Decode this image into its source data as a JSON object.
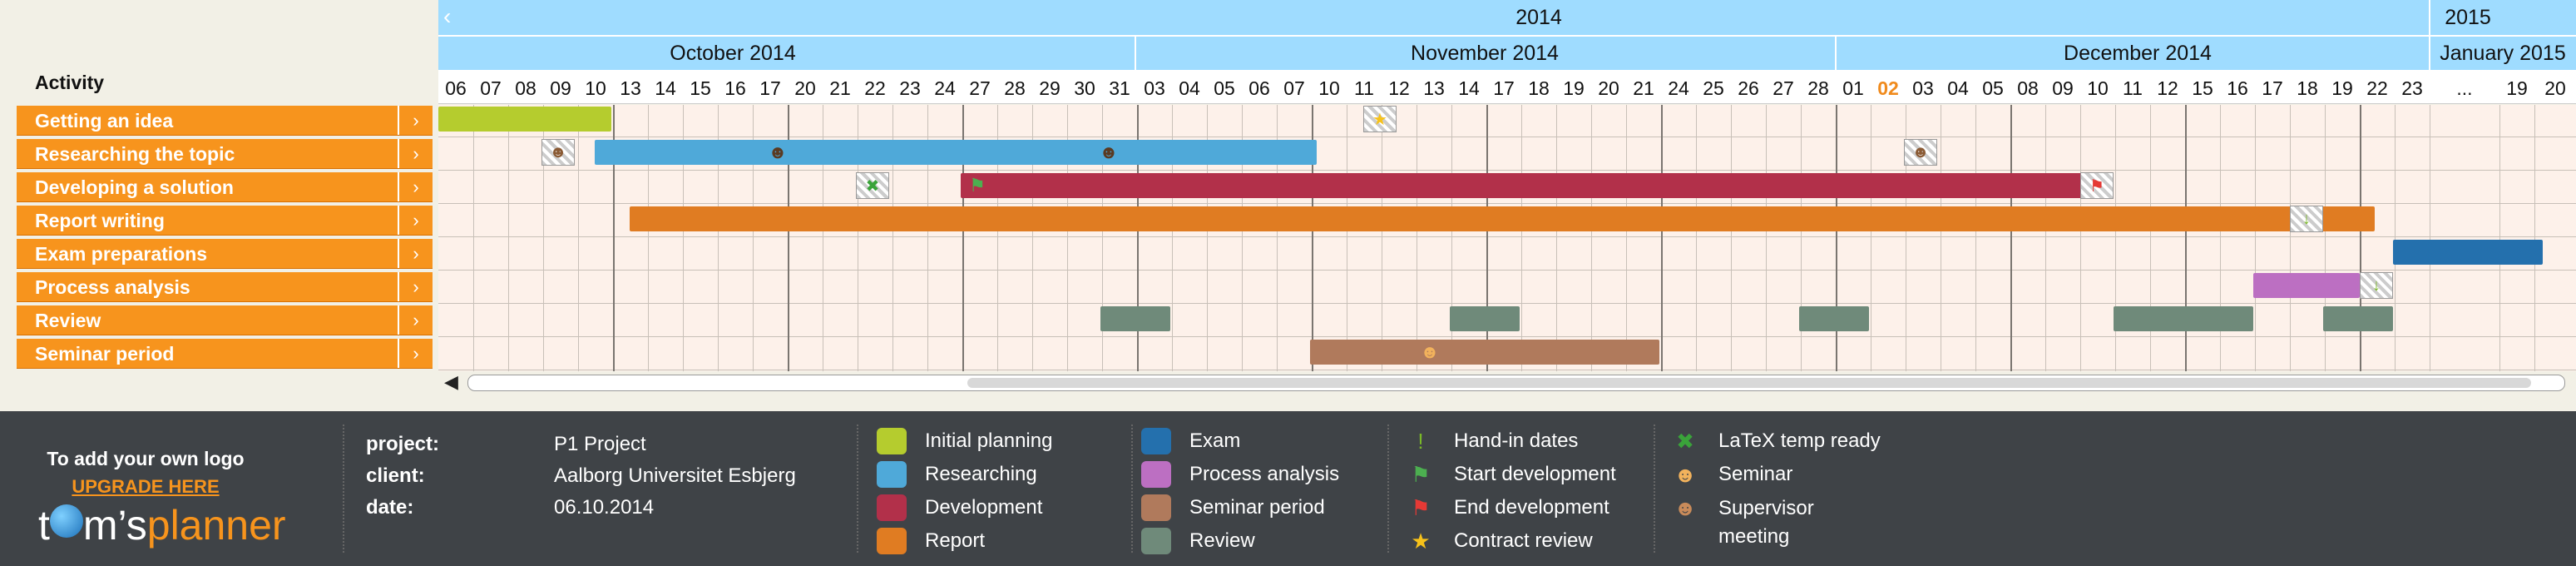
{
  "timeline": {
    "year_row": [
      {
        "name": "year-2014",
        "label": "2014",
        "nav_left": "‹"
      },
      {
        "name": "year-2015",
        "label": "2015"
      }
    ],
    "month_row": [
      {
        "name": "month-oct-2014",
        "label": "October 2014"
      },
      {
        "name": "month-nov-2014",
        "label": "November 2014"
      },
      {
        "name": "month-dec-2014",
        "label": "December 2014"
      },
      {
        "name": "month-jan-2015",
        "label": "January 2015"
      }
    ],
    "days": [
      "06",
      "07",
      "08",
      "09",
      "10",
      "13",
      "14",
      "15",
      "16",
      "17",
      "20",
      "21",
      "22",
      "23",
      "24",
      "27",
      "28",
      "29",
      "30",
      "31",
      "03",
      "04",
      "05",
      "06",
      "07",
      "10",
      "11",
      "12",
      "13",
      "14",
      "17",
      "18",
      "19",
      "20",
      "21",
      "24",
      "25",
      "26",
      "27",
      "28",
      "01",
      "02",
      "03",
      "04",
      "05",
      "08",
      "09",
      "10",
      "11",
      "12",
      "15",
      "16",
      "17",
      "18",
      "19",
      "22",
      "23",
      "...",
      "19",
      "20"
    ],
    "today_label": "02"
  },
  "activity_header": "Activity",
  "activities": [
    {
      "label": "Getting an idea",
      "expand": "›"
    },
    {
      "label": "Researching the topic",
      "expand": "›"
    },
    {
      "label": "Developing a solution",
      "expand": "›"
    },
    {
      "label": "Report writing",
      "expand": "›"
    },
    {
      "label": "Exam preparations",
      "expand": "›"
    },
    {
      "label": "Process analysis",
      "expand": "›"
    },
    {
      "label": "Review",
      "expand": "›"
    },
    {
      "label": "Seminar period",
      "expand": "›"
    }
  ],
  "scrollbar": {
    "left_arrow": "◀",
    "position": 0.24
  },
  "footer": {
    "logo_prompt": "To add your own logo",
    "upgrade_link": "UPGRADE HERE",
    "brand": {
      "t": "t",
      "o": "o",
      "m": "m’s",
      "planner": "planner"
    },
    "project_label": "project:",
    "project_value": "P1 Project",
    "client_label": "client:",
    "client_value": "Aalborg Universitet Esbjerg",
    "date_label": "date:",
    "date_value": "06.10.2014",
    "legend_colors": [
      {
        "label": "Initial planning",
        "color": "#b5cc2e"
      },
      {
        "label": "Researching",
        "color": "#4fa9d9"
      },
      {
        "label": "Development",
        "color": "#b2304a"
      },
      {
        "label": "Report",
        "color": "#e07c22"
      },
      {
        "label": "Exam",
        "color": "#2470ad"
      },
      {
        "label": "Process analysis",
        "color": "#bc6fc2"
      },
      {
        "label": "Seminar period",
        "color": "#b07a5c"
      },
      {
        "label": "Review",
        "color": "#6f8a7a"
      }
    ],
    "legend_markers": [
      {
        "label": "Hand-in dates",
        "icon": "exclamation-icon",
        "glyph": "!",
        "color": "#7ab928"
      },
      {
        "label": "Start development",
        "icon": "flag-green-icon",
        "glyph": "⚑",
        "color": "#4caf50"
      },
      {
        "label": "End development",
        "icon": "flag-red-icon",
        "glyph": "⚑",
        "color": "#e53935"
      },
      {
        "label": "Contract review",
        "icon": "star-icon",
        "glyph": "★",
        "color": "#f7c21a"
      },
      {
        "label": "LaTeX temp ready",
        "icon": "check-x-icon",
        "glyph": "✖",
        "color": "#3aa33a"
      },
      {
        "label": "Seminar",
        "icon": "seminar-person-icon",
        "glyph": "☻",
        "color": "#f2b25c"
      },
      {
        "label": "Supervisor",
        "label2": "meeting",
        "icon": "supervisor-person-icon",
        "glyph": "☻",
        "color": "#c98b5a"
      }
    ]
  }
}
